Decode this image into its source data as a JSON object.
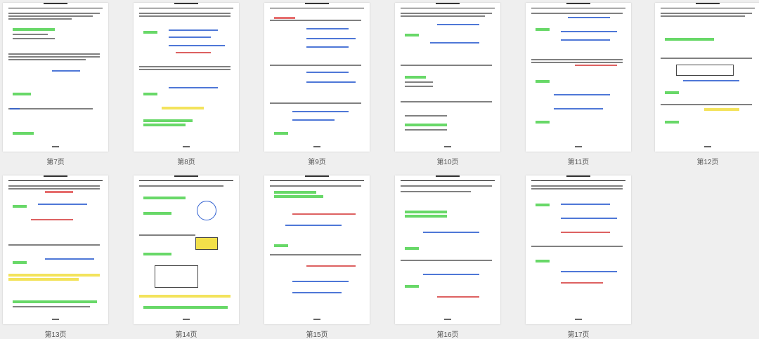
{
  "thumbnails": [
    {
      "label": "第7页"
    },
    {
      "label": "第8页"
    },
    {
      "label": "第9页"
    },
    {
      "label": "第10页"
    },
    {
      "label": "第11页"
    },
    {
      "label": "第12页"
    },
    {
      "label": "第13页"
    },
    {
      "label": "第14页"
    },
    {
      "label": "第15页"
    },
    {
      "label": "第16页"
    },
    {
      "label": "第17页"
    }
  ],
  "colors": {
    "background": "#efefef",
    "page": "#ffffff",
    "highlight_green": "#4dd14d",
    "highlight_yellow": "#f2e04a",
    "ink_blue": "#2f5fd0",
    "ink_red": "#d43a3a"
  }
}
